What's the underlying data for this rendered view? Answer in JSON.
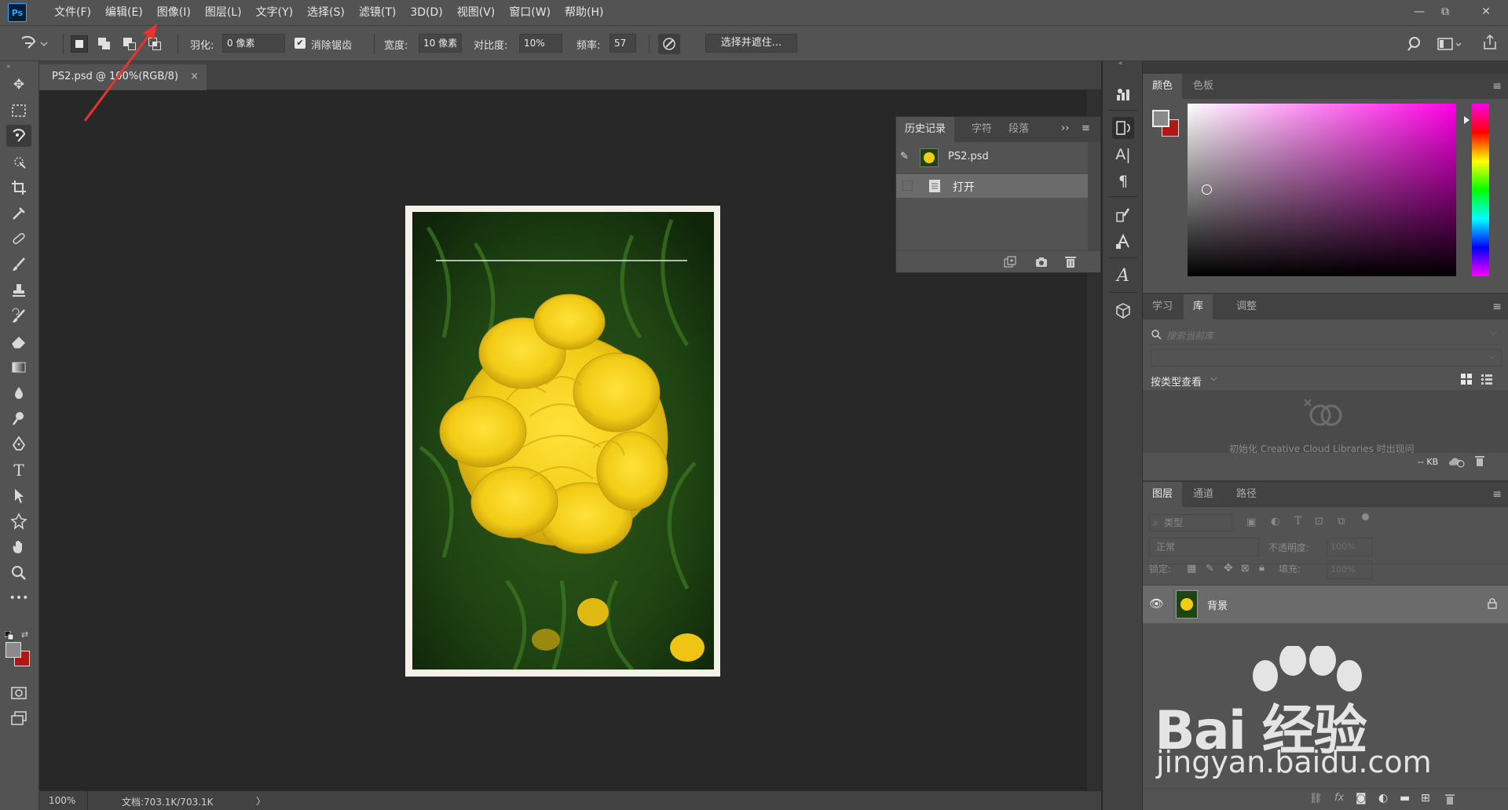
{
  "app": {
    "logo_text": "Ps"
  },
  "menu": [
    "文件(F)",
    "编辑(E)",
    "图像(I)",
    "图层(L)",
    "文字(Y)",
    "选择(S)",
    "滤镜(T)",
    "3D(D)",
    "视图(V)",
    "窗口(W)",
    "帮助(H)"
  ],
  "window_controls": {
    "minimize": "—",
    "restore": "⧉",
    "close": "✕"
  },
  "options": {
    "feather_label": "羽化:",
    "feather_value": "0 像素",
    "antialias_label": "消除锯齿",
    "width_label": "宽度:",
    "width_value": "10 像素",
    "contrast_label": "对比度:",
    "contrast_value": "10%",
    "frequency_label": "频率:",
    "frequency_value": "57",
    "select_mask_label": "选择并遮住..."
  },
  "document": {
    "tab_title": "PS2.psd @ 100%(RGB/8)",
    "tab_close": "×",
    "zoom": "100%",
    "doc_info": "文档:703.1K/703.1K",
    "status_arrow": "〉"
  },
  "history_panel": {
    "tabs": [
      "历史记录",
      "字符",
      "段落"
    ],
    "overflow": "››",
    "snapshot_name": "PS2.psd",
    "step": "打开"
  },
  "color_panel": {
    "tabs": [
      "颜色",
      "色板"
    ]
  },
  "library_panel": {
    "tabs": [
      "学习",
      "库",
      "调整"
    ],
    "search_placeholder": "搜索当前库",
    "view_by": "按类型查看",
    "init_message": "初始化 Creative Cloud Libraries 时出现问",
    "size_label": "-- KB"
  },
  "layers_panel": {
    "tabs": [
      "图层",
      "通道",
      "路径"
    ],
    "filter_label": "类型",
    "blend_mode": "正常",
    "opacity_label": "不透明度:",
    "opacity_value": "100%",
    "lock_label": "锁定:",
    "fill_label": "填充:",
    "fill_value": "100%",
    "layer_name": "背景"
  },
  "watermark": {
    "brand": "Bai 经验",
    "url": "jingyan.baidu.com"
  },
  "colors": {
    "foreground": "#8a8a8a",
    "background": "#b01818",
    "annotation_arrow": "#e8332f"
  }
}
